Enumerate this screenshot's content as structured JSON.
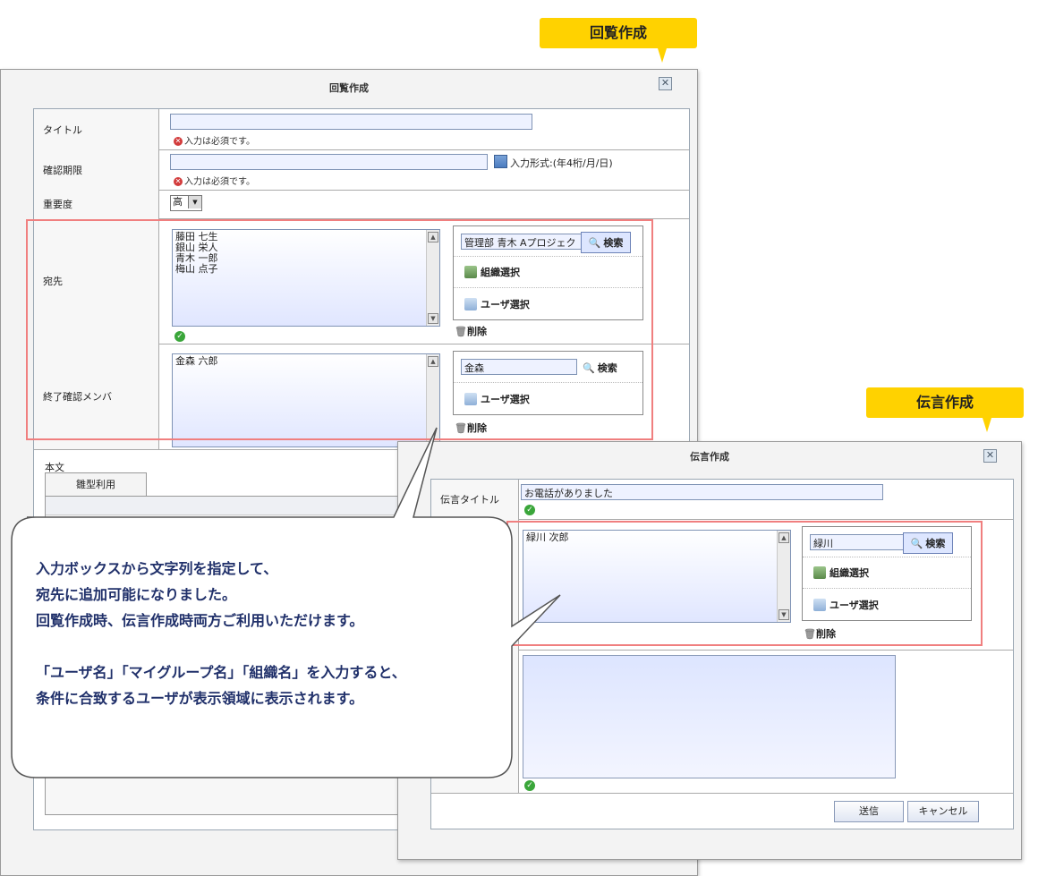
{
  "tags": {
    "kairan_tag": "回覧作成",
    "dengon_tag": "伝言作成"
  },
  "kairan_window": {
    "title": "回覧作成",
    "close_icon": "close-icon",
    "rows": {
      "title_label": "タイトル",
      "title_error": "入力は必須です。",
      "deadline_label": "確認期限",
      "deadline_error": "入力は必須です。",
      "deadline_hint": "入力形式:(年4桁/月/日)",
      "importance_label": "重要度",
      "importance_value": "高",
      "recipients_label": "宛先",
      "recipients": [
        "藤田 七生",
        "銀山 栄人",
        "青木 一郎",
        "梅山 点子"
      ],
      "recipients_search_value": "管理部 青木 Aプロジェク",
      "search_label": "検索",
      "org_select_label": "組織選択",
      "user_select_label": "ユーザ選択",
      "delete_label": "削除",
      "confirm_members_label": "終了確認メンバ",
      "confirm_members": [
        "金森 六郎"
      ],
      "confirm_search_value": "金森",
      "body_label": "本文",
      "template_tab_label": "雛型利用"
    }
  },
  "dengon_window": {
    "title": "伝言作成",
    "close_icon": "close-icon",
    "message_title_label": "伝言タイトル",
    "message_title_value": "お電話がありました",
    "recipients": [
      "緑川 次郎"
    ],
    "recipients_search_value": "緑川",
    "search_label": "検索",
    "org_select_label": "組織選択",
    "user_select_label": "ユーザ選択",
    "delete_label": "削除",
    "send_label": "送信",
    "cancel_label": "キャンセル"
  },
  "callout": {
    "line1": "入力ボックスから文字列を指定して、",
    "line2": "宛先に追加可能になりました。",
    "line3": "回覧作成時、伝言作成時両方ご利用いただけます。",
    "line4": "「ユーザ名」「マイグループ名」「組織名」を入力すると、",
    "line5": "条件に合致するユーザが表示領域に表示されます。"
  },
  "colors": {
    "tag_yellow": "#ffd200",
    "highlight_red": "#f07f7f",
    "callout_text": "#20306a"
  }
}
